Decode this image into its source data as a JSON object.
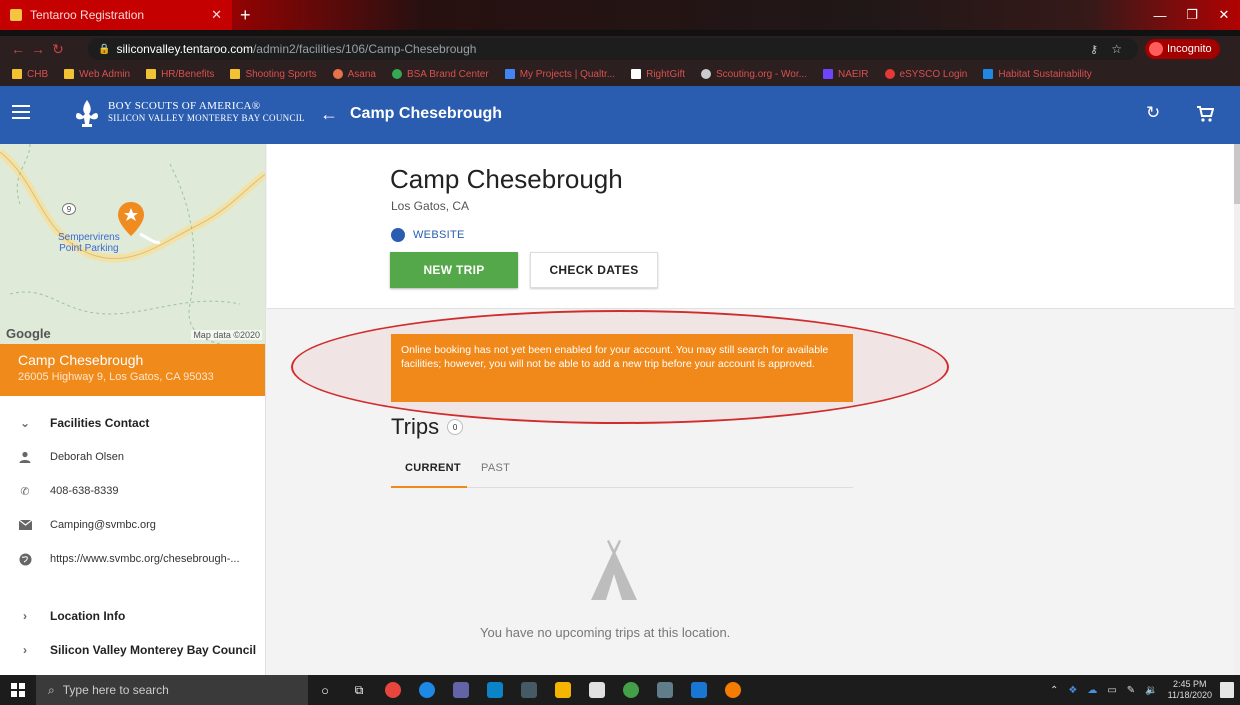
{
  "browser": {
    "tab_title": "Tentaroo Registration",
    "new_tab_symbol": "+",
    "url_host": "siliconvalley.tentaroo.com",
    "url_path": "/admin2/facilities/106/Camp-Chesebrough",
    "incognito_label": "Incognito",
    "bookmarks": [
      "CHB",
      "Web Admin",
      "HR/Benefits",
      "Shooting Sports",
      "Asana",
      "BSA Brand Center",
      "My Projects | Qualtr...",
      "RightGift",
      "Scouting.org - Wor...",
      "NAEIR",
      "eSYSCO Login",
      "Habitat Sustainability"
    ]
  },
  "appbar": {
    "brand_line1": "BOY SCOUTS OF AMERICA®",
    "brand_line2": "SILICON VALLEY MONTEREY BAY COUNCIL",
    "title": "Camp Chesebrough",
    "back_symbol": "←",
    "refresh_symbol": "↻"
  },
  "map": {
    "place_label_1": "Sempervirens",
    "place_label_2": "Point Parking",
    "road_marker": "9",
    "logo": "Google",
    "attribution": "Map data ©2020"
  },
  "facility": {
    "name": "Camp Chesebrough",
    "address": "26005 Highway 9, Los Gatos, CA 95033",
    "location": "Los Gatos, CA",
    "website_label": "WEBSITE"
  },
  "contact": {
    "heading": "Facilities Contact",
    "name": "Deborah Olsen",
    "phone": "408-638-8339",
    "email": "Camping@svmbc.org",
    "url": "https://www.svmbc.org/chesebrough-..."
  },
  "sections": {
    "location_info": "Location Info",
    "council": "Silicon Valley Monterey Bay Council"
  },
  "actions": {
    "new_trip": "NEW TRIP",
    "check_dates": "CHECK DATES"
  },
  "alert": {
    "message": "Online booking has not yet been enabled for your account. You may still search for available facilities; however, you will not be able to add a new trip before your account is approved."
  },
  "trips": {
    "title": "Trips",
    "count": "0",
    "tabs": [
      "CURRENT",
      "PAST"
    ],
    "empty_message": "You have no upcoming trips at this location."
  },
  "taskbar": {
    "search_placeholder": "Type here to search",
    "time": "2:45 PM",
    "date": "11/18/2020"
  },
  "colors": {
    "appbar": "#2a5db0",
    "accent_orange": "#ef8a1b",
    "new_trip_green": "#55a84a",
    "annotation_red": "#d12c2c"
  }
}
